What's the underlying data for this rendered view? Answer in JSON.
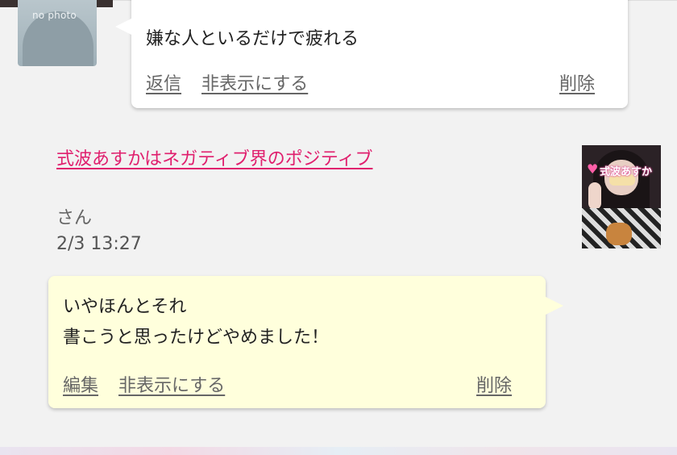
{
  "comments": [
    {
      "avatar": {
        "type": "no-photo",
        "text": "no photo",
        "icon": "no-photo-silhouette"
      },
      "message": "嫌な人といるだけで疲れる",
      "actions": {
        "reply": "返信",
        "hide": "非表示にする",
        "delete": "削除"
      },
      "bubble_color": "#ffffff"
    },
    {
      "poster": {
        "name": "式波あすかはネガティブ界のポジティブ",
        "suffix": "さん"
      },
      "time": "2/3 13:27",
      "avatar": {
        "type": "photo",
        "overlay_text": "式波あすか"
      },
      "message_lines": [
        "いやほんとそれ",
        "書こうと思ったけどやめました！"
      ],
      "actions": {
        "edit": "編集",
        "hide": "非表示にする",
        "delete": "削除"
      },
      "bubble_color": "#ffffdc"
    }
  ],
  "colors": {
    "link": "#e0206e",
    "action": "#666666",
    "background": "#f2f2f2"
  }
}
